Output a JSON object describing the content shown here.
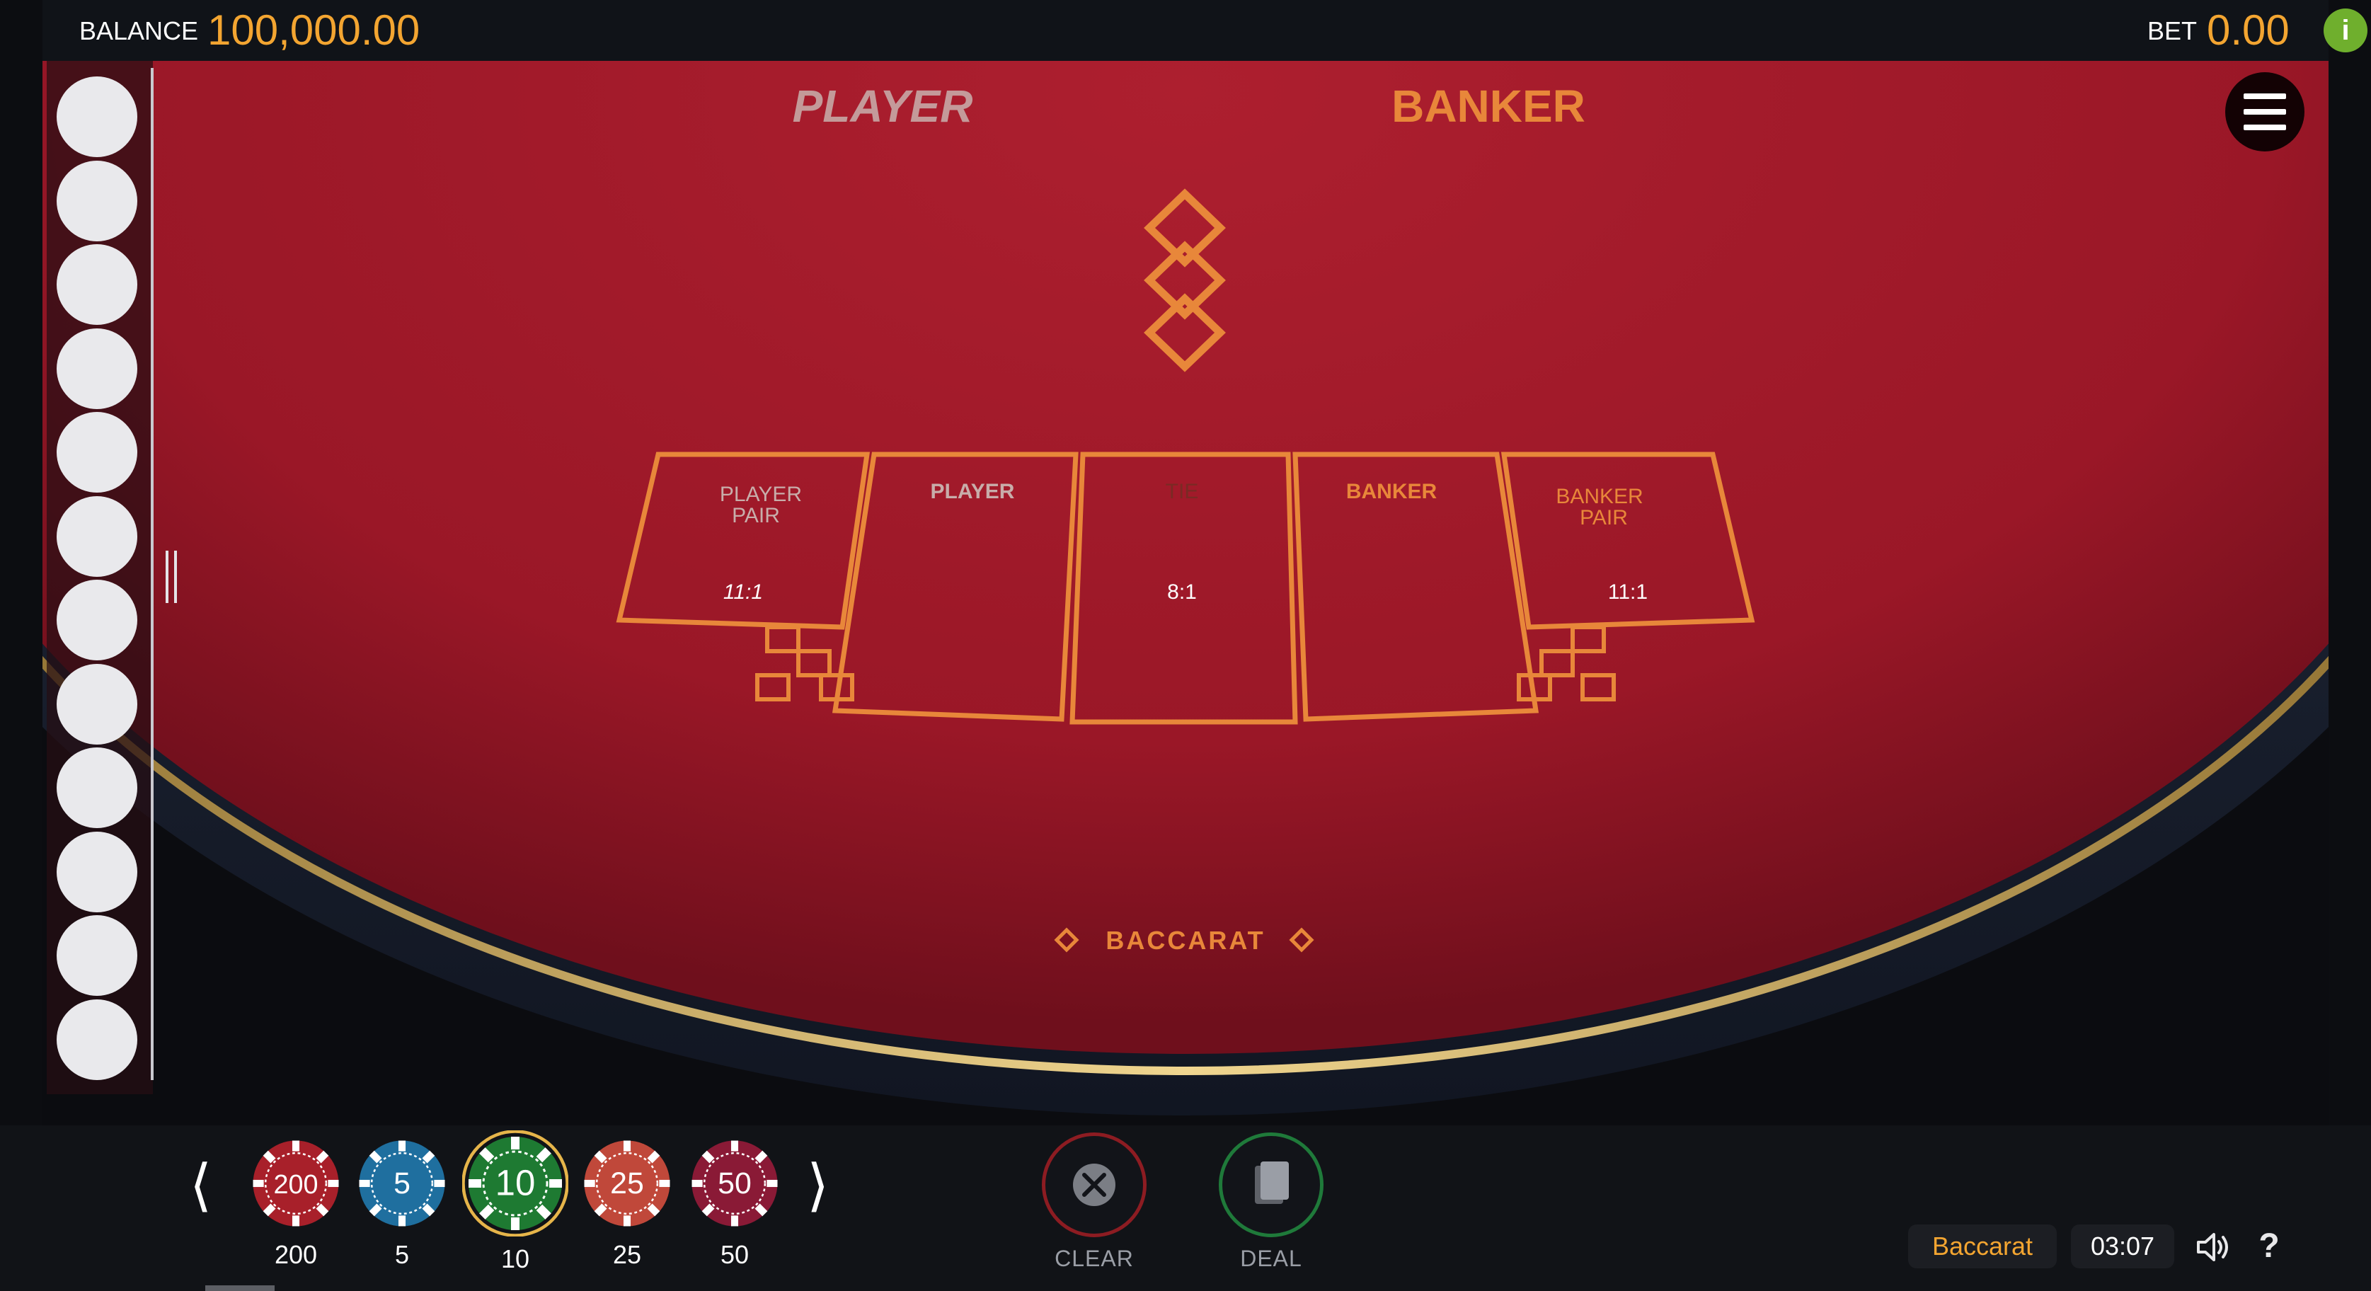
{
  "header": {
    "balance_label": "BALANCE",
    "balance_value": "100,000.00",
    "bet_label": "BET",
    "bet_value": "0.00",
    "info_symbol": "i"
  },
  "table": {
    "side_labels": {
      "player": "PLAYER",
      "banker": "BANKER"
    },
    "bet_spots": [
      {
        "name": "PLAYER PAIR",
        "lines": [
          "PLAYER",
          "PAIR"
        ],
        "odds": "11:1",
        "color": "#c8adaa"
      },
      {
        "name": "PLAYER",
        "lines": [
          "PLAYER"
        ],
        "odds": "",
        "color": "#c8adaa"
      },
      {
        "name": "TIE",
        "lines": [
          "TIE"
        ],
        "odds": "8:1",
        "color": "#7a2a24"
      },
      {
        "name": "BANKER",
        "lines": [
          "BANKER"
        ],
        "odds": "",
        "color": "#e8873a"
      },
      {
        "name": "BANKER PAIR",
        "lines": [
          "BANKER",
          "PAIR"
        ],
        "odds": "11:1",
        "color": "#e8873a"
      }
    ],
    "logo_text": "BACCARAT",
    "felt_color": "#a31a29",
    "accent_color": "#e8873a"
  },
  "road": {
    "slot_count": 12
  },
  "chips": [
    {
      "value": "200",
      "label": "200",
      "color": "#a8202a",
      "selected": false
    },
    {
      "value": "5",
      "label": "5",
      "color": "#1f6f9f",
      "selected": false
    },
    {
      "value": "10",
      "label": "10",
      "color": "#1e7a32",
      "selected": true
    },
    {
      "value": "25",
      "label": "25",
      "color": "#c0483a",
      "selected": false
    },
    {
      "value": "50",
      "label": "50",
      "color": "#8a1a36",
      "selected": false
    }
  ],
  "controls": {
    "prev_arrow": "⟨",
    "next_arrow": "⟩",
    "clear_label": "CLEAR",
    "deal_label": "DEAL",
    "clear_ring_color": "#8d1c22",
    "deal_ring_color": "#1f7a3a"
  },
  "footer": {
    "game_name": "Baccarat",
    "clock": "03:07",
    "help_symbol": "?"
  }
}
